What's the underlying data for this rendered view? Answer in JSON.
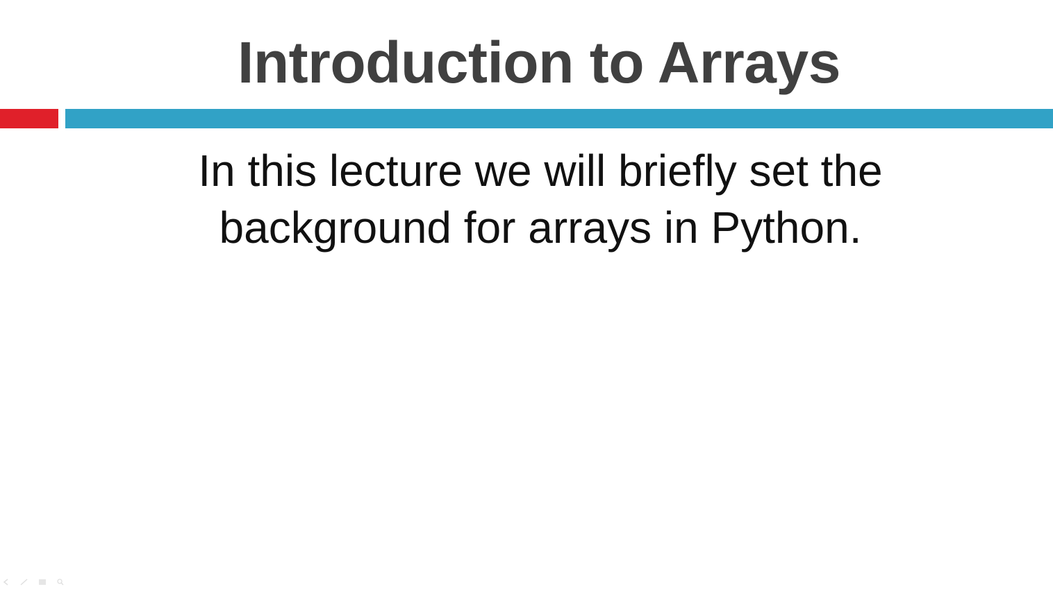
{
  "slide": {
    "title": "Introduction to Arrays",
    "body_lines": [
      "In this lecture we will briefly set the",
      "background for arrays in Python."
    ]
  },
  "colors": {
    "title_text": "#404040",
    "accent_red": "#e0202a",
    "accent_blue": "#31a2c6",
    "body_text": "#111111",
    "background": "#ffffff"
  },
  "presenter_controls": {
    "icons": [
      "previous-icon",
      "pen-icon",
      "slides-icon",
      "zoom-icon"
    ]
  }
}
